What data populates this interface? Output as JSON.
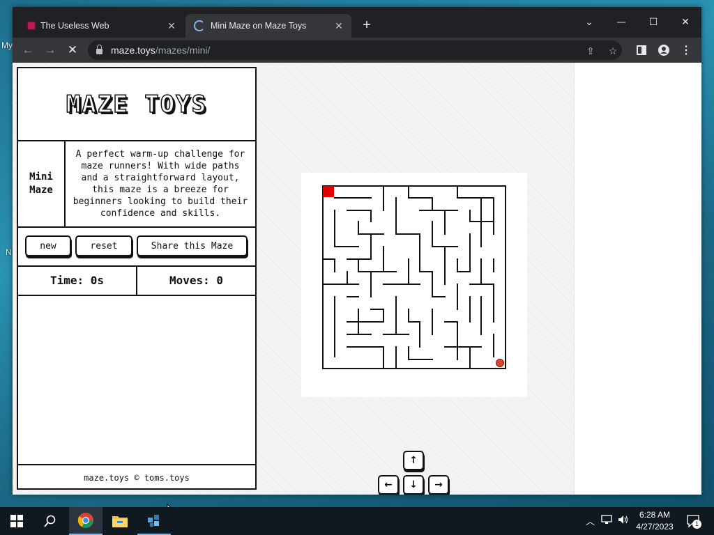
{
  "desktop": {
    "labels": [
      "My",
      "N"
    ]
  },
  "browser": {
    "tabs": [
      {
        "title": "The Useless Web",
        "active": false
      },
      {
        "title": "Mini Maze on Maze Toys",
        "active": true,
        "loading": true
      }
    ],
    "new_tab_symbol": "+",
    "window_controls": {
      "dropdown": "⌄",
      "minimize": "—",
      "maximize": "☐",
      "close": "✕"
    },
    "nav": {
      "back": "←",
      "forward": "→",
      "stop": "✕"
    },
    "url_host": "maze.toys",
    "url_path": "/mazes/mini/",
    "icons": [
      "share-icon",
      "star-icon",
      "side-panel-icon",
      "profile-icon",
      "menu-icon"
    ]
  },
  "page": {
    "logo": "MAZE TOYS",
    "maze_name": "Mini Maze",
    "description": "A perfect warm-up challenge for maze runners! With wide paths and a straightforward layout, this maze is a breeze for beginners looking to build their confidence and skills.",
    "buttons": {
      "new": "new",
      "reset": "reset",
      "share": "Share this Maze"
    },
    "time_label": "Time:",
    "time_value": "0s",
    "moves_label": "Moves:",
    "moves_value": "0",
    "footer": "maze.toys © toms.toys",
    "arrows": {
      "up": "↑",
      "left": "←",
      "down": "↓",
      "right": "→"
    },
    "colors": {
      "start": "#e50000",
      "goal": "#d9472b",
      "ink": "#111111"
    }
  },
  "taskbar": {
    "time": "6:28 AM",
    "date": "4/27/2023",
    "notification_count": "1",
    "apps": [
      "start-icon",
      "search-icon",
      "chrome-icon",
      "file-explorer-icon",
      "app-icon"
    ]
  }
}
